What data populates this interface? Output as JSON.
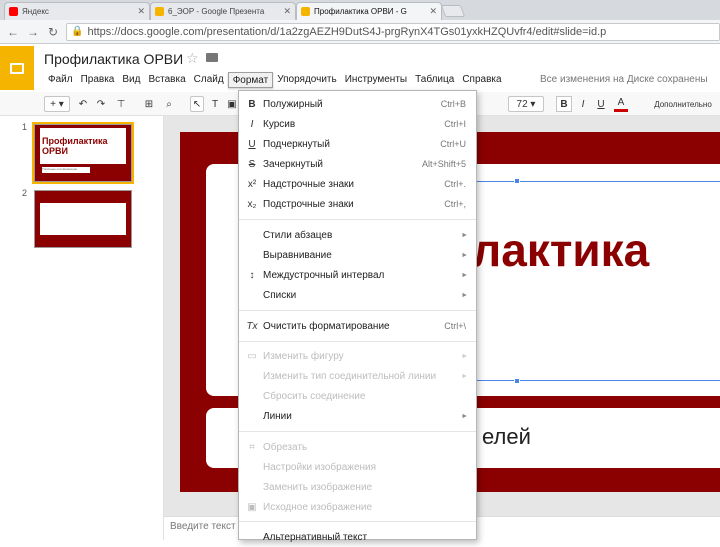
{
  "browser": {
    "tabs": [
      {
        "title": "Яндекс",
        "color": "#ff0000"
      },
      {
        "title": "6_ЭОР - Google Презента",
        "color": "#f4b400"
      },
      {
        "title": "Профилактика ОРВИ - G",
        "color": "#f4b400"
      }
    ],
    "url": "https://docs.google.com/presentation/d/1a2zgAEZH9DutS4J-prgRynX4TGs01yxkHZQUvfr4/edit#slide=id.p"
  },
  "app": {
    "title": "Профилактика ОРВИ",
    "menu": [
      "Файл",
      "Правка",
      "Вид",
      "Вставка",
      "Слайд",
      "Формат",
      "Упорядочить",
      "Инструменты",
      "Таблица",
      "Справка"
    ],
    "save_status": "Все изменения на Диске сохранены"
  },
  "toolbar": {
    "font_size": "72",
    "bold": "B",
    "italic": "I",
    "underline": "U",
    "text_color": "A",
    "more": "Дополнительно"
  },
  "filmstrip": {
    "slides": [
      {
        "num": "1",
        "title": "Профилактика ОРВИ",
        "subtitle": "Типичные составляющие"
      },
      {
        "num": "2",
        "title": "",
        "subtitle": ""
      }
    ]
  },
  "slide": {
    "title": "лактика",
    "subtitle": "елей"
  },
  "notes": {
    "placeholder": "Введите текст"
  },
  "format_menu": {
    "items": [
      {
        "icon": "B",
        "label": "Полужирный",
        "shortcut": "Ctrl+B"
      },
      {
        "icon": "I",
        "label": "Курсив",
        "shortcut": "Ctrl+I"
      },
      {
        "icon": "U",
        "label": "Подчеркнутый",
        "shortcut": "Ctrl+U"
      },
      {
        "icon": "S",
        "label": "Зачеркнутый",
        "shortcut": "Alt+Shift+5"
      },
      {
        "icon": "x²",
        "label": "Надстрочные знаки",
        "shortcut": "Ctrl+."
      },
      {
        "icon": "x₂",
        "label": "Подстрочные знаки",
        "shortcut": "Ctrl+,"
      },
      {
        "icon": "",
        "label": "Стили абзацев",
        "shortcut": ""
      },
      {
        "icon": "",
        "label": "Выравнивание",
        "shortcut": ""
      },
      {
        "icon": "↕",
        "label": "Междустрочный интервал",
        "shortcut": ""
      },
      {
        "icon": "",
        "label": "Списки",
        "shortcut": ""
      },
      {
        "icon": "Tx",
        "label": "Очистить форматирование",
        "shortcut": "Ctrl+\\"
      },
      {
        "icon": "",
        "label": "Изменить фигуру",
        "shortcut": ""
      },
      {
        "icon": "",
        "label": "Изменить тип соединительной линии",
        "shortcut": ""
      },
      {
        "icon": "",
        "label": "Сбросить соединение",
        "shortcut": ""
      },
      {
        "icon": "",
        "label": "Линии",
        "shortcut": ""
      },
      {
        "icon": "⌗",
        "label": "Обрезать",
        "shortcut": ""
      },
      {
        "icon": "",
        "label": "Настройки изображения",
        "shortcut": ""
      },
      {
        "icon": "",
        "label": "Заменить изображение",
        "shortcut": ""
      },
      {
        "icon": "",
        "label": "Исходное изображение",
        "shortcut": ""
      },
      {
        "icon": "",
        "label": "Альтернативный текст",
        "shortcut": ""
      }
    ]
  }
}
